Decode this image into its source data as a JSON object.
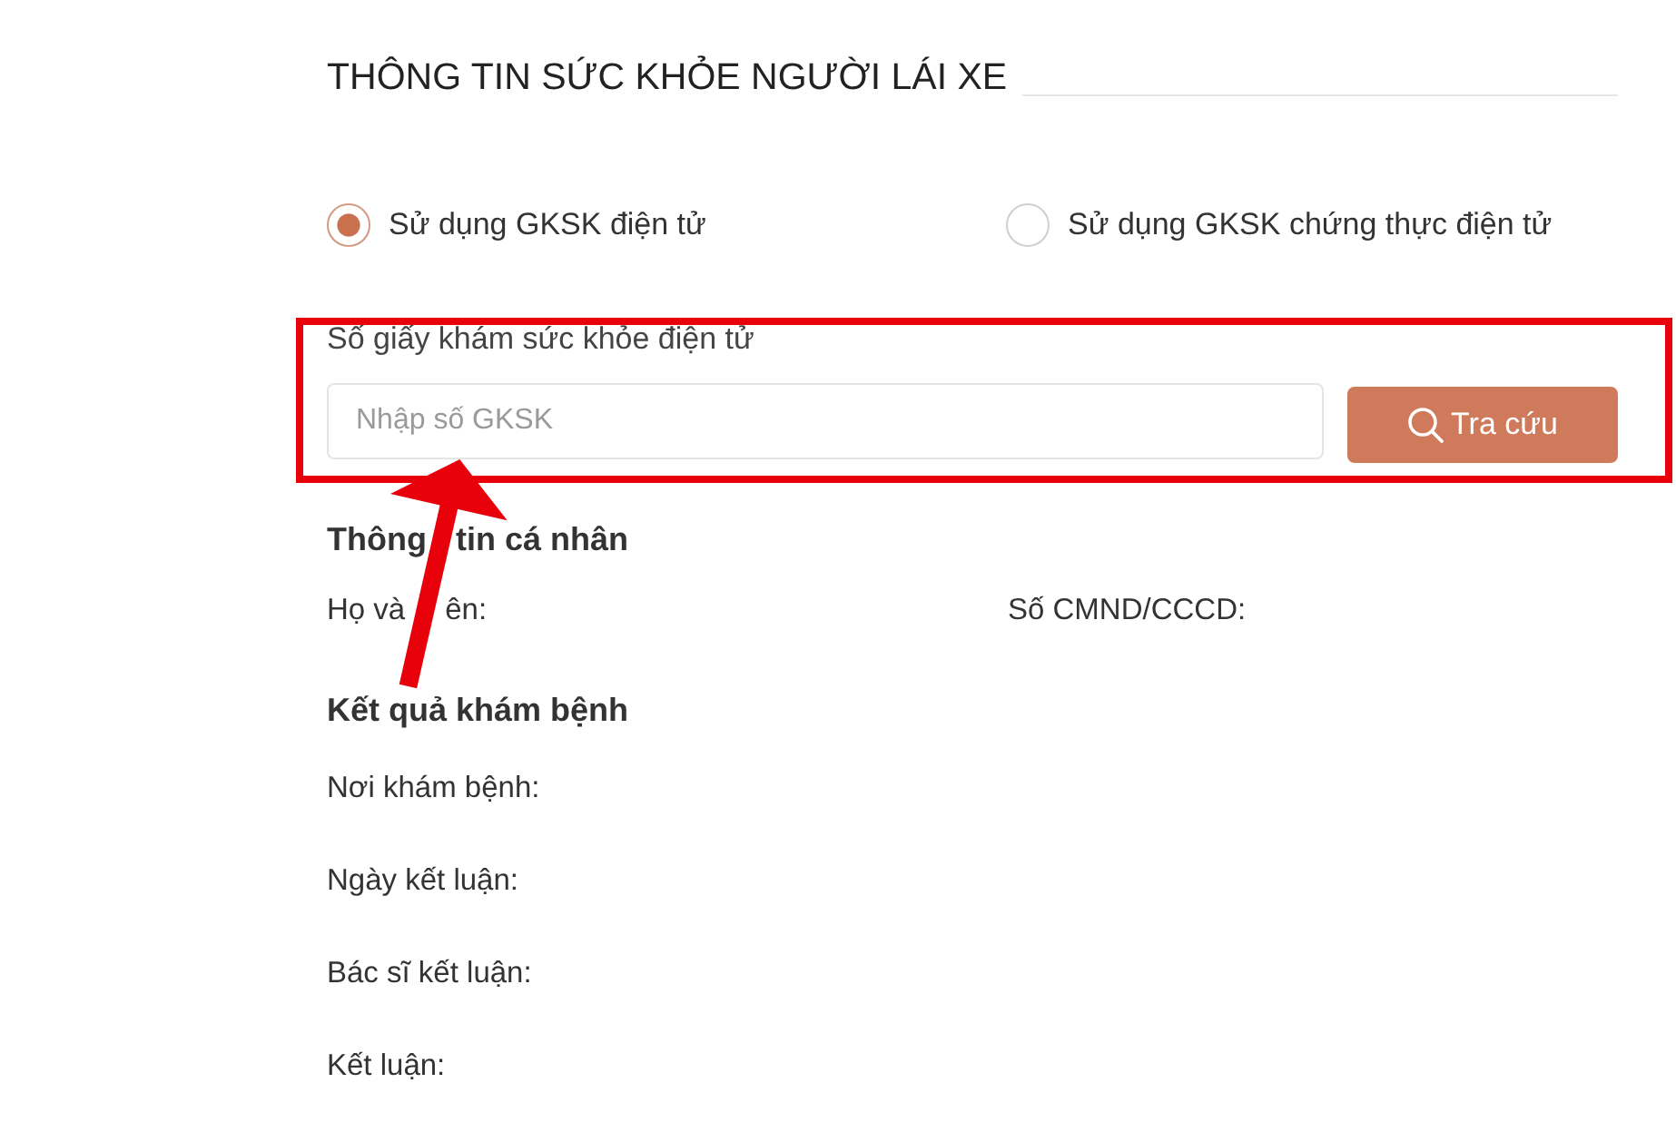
{
  "section": {
    "title": "THÔNG TIN SỨC KHỎE NGƯỜI LÁI XE"
  },
  "options": [
    {
      "label": "Sử dụng GKSK điện tử",
      "selected": true
    },
    {
      "label": "Sử dụng GKSK chứng thực điện tử",
      "selected": false
    }
  ],
  "lookup": {
    "label": "Số giấy khám sức khỏe điện tử",
    "placeholder": "Nhập số GKSK",
    "button": "Tra cứu"
  },
  "personal": {
    "heading": [
      "Thông",
      "tin cá nhân"
    ],
    "fields": [
      [
        "Họ và",
        "ên:"
      ],
      [
        "Số CMND/CCCD:"
      ]
    ]
  },
  "results": {
    "heading": "Kết quả khám bệnh",
    "fields": [
      "Nơi khám bệnh:",
      "Ngày kết luận:",
      "Bác sĩ kết luận:",
      "Kết luận:"
    ]
  }
}
